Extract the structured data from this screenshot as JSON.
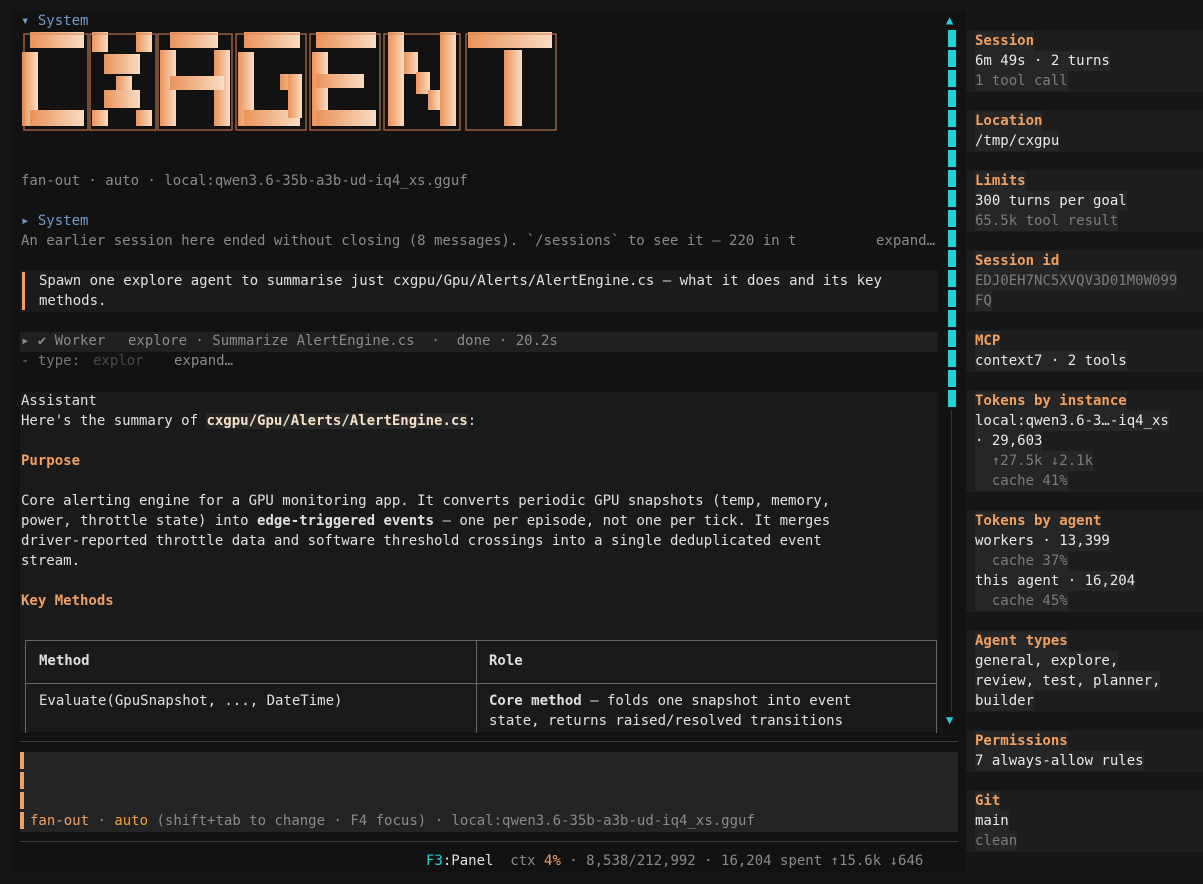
{
  "system_header": "▾ System",
  "logo_text": "CXAGENT",
  "model_line": "fan-out · auto · local:qwen3.6-35b-a3b-ud-iq4_xs.gguf",
  "system2_header": "▸ System",
  "earlier_session": "An earlier session here ended without closing (8 messages). `/sessions` to see it — 220 in t",
  "earlier_expand": "expand…",
  "user_prompt_line1": "Spawn one explore agent to summarise just cxgpu/Gpu/Alerts/AlertEngine.cs — what it does and its key",
  "user_prompt_line2": "methods.",
  "worker": {
    "prefix": "▸ ✔ Worker",
    "detail": "explore · Summarize AlertEngine.cs  ·  done · 20.2s",
    "type_prefix": "- type: ",
    "type_value": "explor",
    "expand": "expand…"
  },
  "assistant": {
    "label": "Assistant",
    "intro_prefix": "Here's the summary of ",
    "intro_file": "cxgpu/Gpu/Alerts/AlertEngine.cs",
    "intro_suffix": ":",
    "purpose_heading": "Purpose",
    "purpose_l1": "Core alerting engine for a GPU monitoring app. It converts periodic GPU snapshots (temp, memory,",
    "purpose_l2a": "power, throttle state) into ",
    "purpose_l2b": "edge-triggered events",
    "purpose_l2c": " — one per episode, not one per tick. It merges",
    "purpose_l3": "driver-reported throttle data and software threshold crossings into a single deduplicated event",
    "purpose_l4": "stream.",
    "methods_heading": "Key Methods",
    "table": {
      "headers": [
        "Method",
        "Role"
      ],
      "row1_method": "Evaluate(GpuSnapshot, ..., DateTime)",
      "row1_role_bold": "Core method",
      "row1_role_l1": " — folds one snapshot into event",
      "row1_role_l2": "state, returns raised/resolved transitions"
    }
  },
  "input": {
    "mode1": "fan-out",
    "sep": " · ",
    "mode2": "auto",
    "hint": " (shift+tab to change · F4 focus) · local:qwen3.6-35b-a3b-ud-iq4_xs.gguf"
  },
  "status": {
    "key": "F3",
    "panel": ":Panel",
    "ctx_label": "ctx ",
    "ctx_pct": "4%",
    "rest": " · 8,538/212,992 · 16,204 spent ↑15.6k ↓646"
  },
  "side": {
    "session": {
      "head": "Session",
      "l1": "6m 49s · 2 turns",
      "l2": "1 tool call"
    },
    "location": {
      "head": "Location",
      "l1": "/tmp/cxgpu"
    },
    "limits": {
      "head": "Limits",
      "l1": "300 turns per goal",
      "l2": "65.5k tool result"
    },
    "session_id": {
      "head": "Session id",
      "l1": "EDJ0EH7NC5XVQV3D01M0W099",
      "l2": "FQ"
    },
    "mcp": {
      "head": "MCP",
      "l1": "context7 · 2 tools"
    },
    "tokens_instance": {
      "head": "Tokens by instance",
      "l1": "local:qwen3.6-3…-iq4_xs",
      "l2": "· 29,603",
      "l3": "  ↑27.5k ↓2.1k",
      "l4": "  cache 41%"
    },
    "tokens_agent": {
      "head": "Tokens by agent",
      "l1": "workers · 13,399",
      "l2": "  cache 37%",
      "l3": "this agent · 16,204",
      "l4": "  cache 45%"
    },
    "agent_types": {
      "head": "Agent types",
      "l1": "general, explore,",
      "l2": "review, test, planner,",
      "l3": "builder"
    },
    "permissions": {
      "head": "Permissions",
      "l1": "7 always-allow rules"
    },
    "git": {
      "head": "Git",
      "l1": "main",
      "l2": "clean"
    }
  },
  "colors": {
    "accent": "#f0a060",
    "cyan": "#1dd3d8",
    "blue": "#6f9cc9"
  }
}
